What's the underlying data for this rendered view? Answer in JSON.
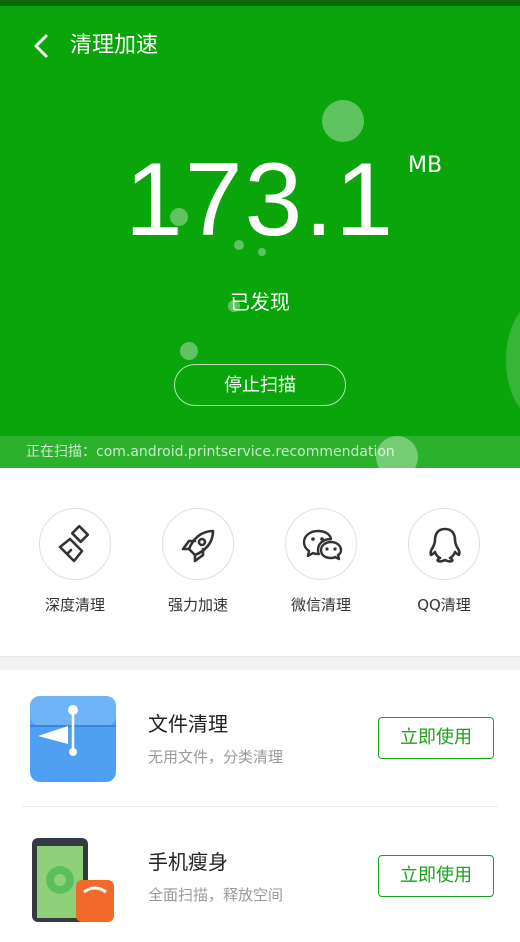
{
  "header": {
    "title": "清理加速"
  },
  "scan": {
    "amount": "173.1",
    "unit": "MB",
    "status": "已发现",
    "stop_label": "停止扫描",
    "scanning_text": "正在扫描：com.android.printservice.recommendation"
  },
  "tools": [
    {
      "label": "深度清理",
      "icon": "broom-icon"
    },
    {
      "label": "强力加速",
      "icon": "rocket-icon"
    },
    {
      "label": "微信清理",
      "icon": "wechat-icon"
    },
    {
      "label": "QQ清理",
      "icon": "qq-icon"
    }
  ],
  "cards": [
    {
      "title": "文件清理",
      "desc": "无用文件，分类清理",
      "button": "立即使用",
      "icon": "file-clean-icon"
    },
    {
      "title": "手机瘦身",
      "desc": "全面扫描，释放空间",
      "button": "立即使用",
      "icon": "phone-slim-icon"
    }
  ],
  "colors": {
    "primary": "#0aa50a",
    "accent": "#1aa31a"
  }
}
